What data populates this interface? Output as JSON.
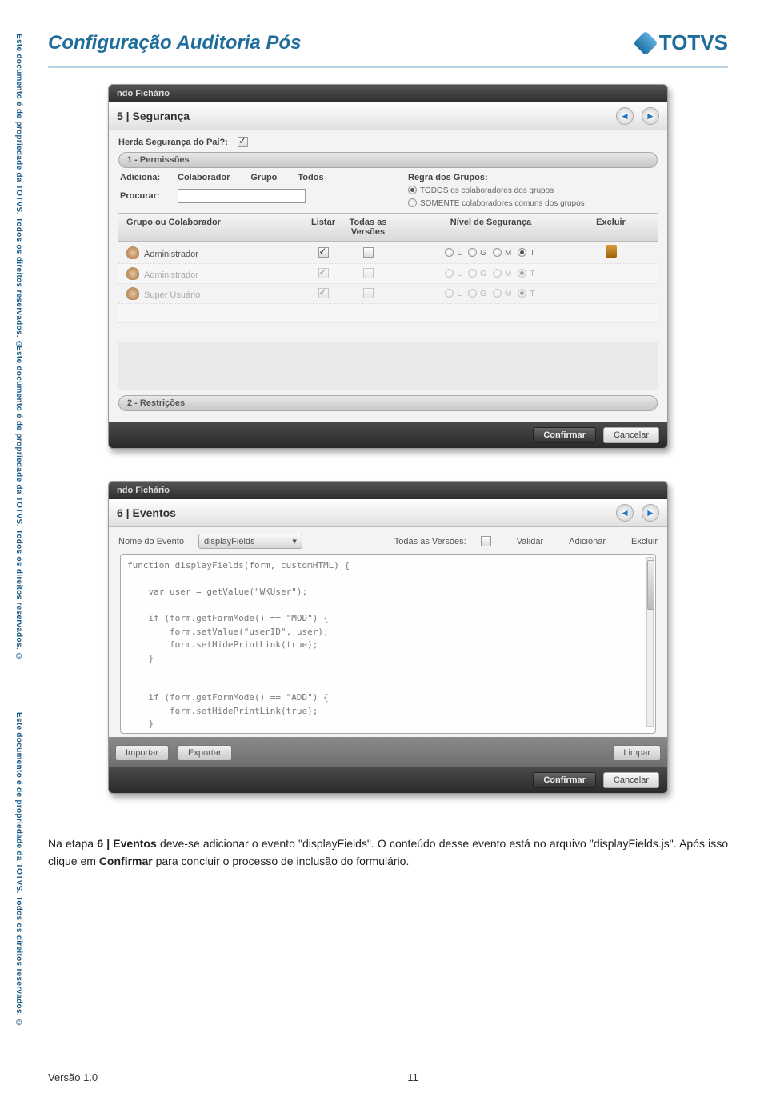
{
  "doc": {
    "title": "Configuração Auditoria Pós",
    "brand": "TOTVS",
    "version": "Versão 1.0",
    "pagenum": "11"
  },
  "side": {
    "copyright": "Este documento é de propriedade da TOTVS. Todos os direitos reservados. ©"
  },
  "common": {
    "confirmar": "Confirmar",
    "cancelar": "Cancelar"
  },
  "shot1": {
    "windowtitle": "ndo Fichário",
    "step": "5 | Segurança",
    "herda_label": "Herda Segurança do Pai?:",
    "sec1": "1 - Permissões",
    "sec2": "2 - Restrições",
    "adiciona": "Adiciona:",
    "colaborador": "Colaborador",
    "grupo": "Grupo",
    "todos": "Todos",
    "procurar": "Procurar:",
    "regra": "Regra dos Grupos:",
    "regra_opt1": "TODOS os colaboradores dos grupos",
    "regra_opt2": "SOMENTE colaboradores comuns dos grupos",
    "cols": [
      "Grupo ou Colaborador",
      "Listar",
      "Todas as Versões",
      "Nível de Segurança",
      "Excluir"
    ],
    "niv": [
      "L",
      "G",
      "M",
      "T"
    ],
    "rows": [
      {
        "name": "Administrador"
      },
      {
        "name": "Administrador"
      },
      {
        "name": "Super Usuário"
      }
    ]
  },
  "shot2": {
    "windowtitle": "ndo Fichário",
    "step": "6 | Eventos",
    "nome_label": "Nome do Evento",
    "dropdown_value": "displayFields",
    "todas_versoes": "Todas as Versões:",
    "validar": "Validar",
    "adicionar": "Adicionar",
    "excluir": "Excluir",
    "importar": "Importar",
    "exportar": "Exportar",
    "limpar": "Limpar",
    "code": "function displayFields(form, customHTML) {\n\n    var user = getValue(\"WKUser\");\n\n    if (form.getFormMode() == \"MOD\") {\n        form.setValue(\"userID\", user);\n        form.setHidePrintLink(true);\n    }\n\n\n    if (form.getFormMode() == \"ADD\") {\n        form.setHidePrintLink(true);\n    }\n\n\n    if (form.getFormMode() == \"VIEW\") {"
  },
  "body": {
    "p1": "Na etapa ",
    "b1": "6 | Eventos",
    "p2": " deve-se adicionar o evento \"displayFields\". O conteúdo desse evento está no arquivo \"displayFields.js\". Após isso clique em ",
    "b2": "Confirmar",
    "p3": " para concluir o processo de inclusão do formulário."
  }
}
